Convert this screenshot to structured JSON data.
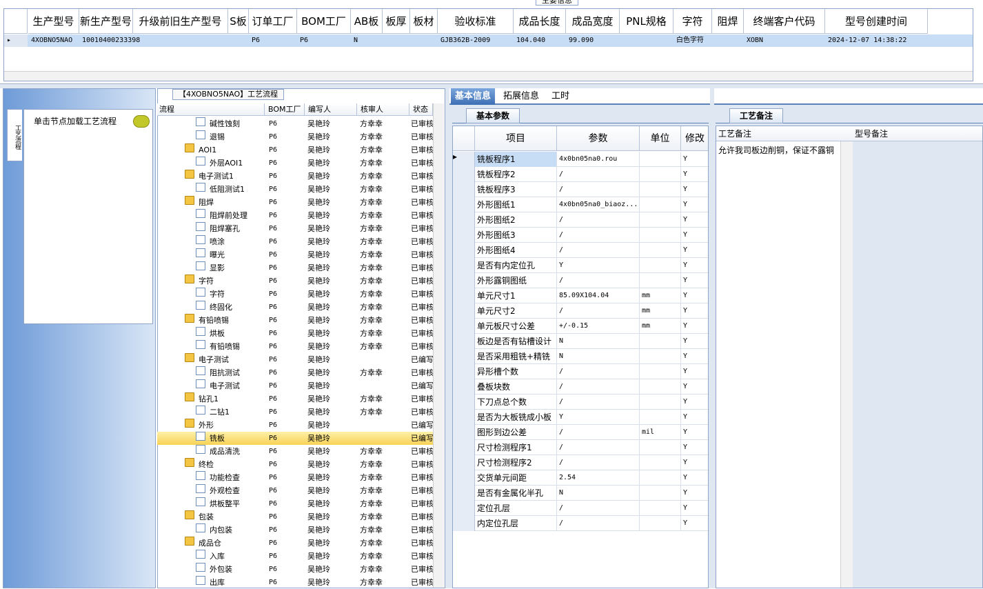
{
  "top": {
    "legend": "主要信息",
    "columns": [
      "生产型号",
      "新生产型号",
      "升级前旧生产型号",
      "S板",
      "订单工厂",
      "BOM工厂",
      "AB板",
      "板厚",
      "板材",
      "验收标准",
      "成品长度",
      "成品宽度",
      "PNL规格",
      "字符",
      "阻焊",
      "终端客户代码",
      "型号创建时间"
    ],
    "row": [
      "4XOBNO5NAO",
      "10010400233398",
      "",
      "",
      "P6",
      "P6",
      "N",
      "",
      "",
      "GJB362B-2009",
      "104.040",
      "99.090",
      "",
      "白色字符",
      "",
      "XOBN",
      "2024-12-07 14:38:22"
    ]
  },
  "left": {
    "vertical_tab": "工艺流程",
    "load_hint": "单击节点加载工艺流程"
  },
  "tree": {
    "legend": "【4XOBNO5NAO】工艺流程",
    "headers": [
      "流程",
      "BOM工厂",
      "编写人",
      "核审人",
      "状态"
    ],
    "nodes": [
      {
        "label": "碱性蚀刻",
        "level": 2,
        "folder": false,
        "bom": "P6",
        "writer": "吴艳玲",
        "checker": "方幸幸",
        "status": "已审核"
      },
      {
        "label": "退锡",
        "level": 2,
        "folder": false,
        "bom": "P6",
        "writer": "吴艳玲",
        "checker": "方幸幸",
        "status": "已审核"
      },
      {
        "label": "AOI1",
        "level": 1,
        "folder": true,
        "bom": "P6",
        "writer": "吴艳玲",
        "checker": "方幸幸",
        "status": "已审核"
      },
      {
        "label": "外层AOI1",
        "level": 2,
        "folder": false,
        "bom": "P6",
        "writer": "吴艳玲",
        "checker": "方幸幸",
        "status": "已审核"
      },
      {
        "label": "电子测试1",
        "level": 1,
        "folder": true,
        "bom": "P6",
        "writer": "吴艳玲",
        "checker": "方幸幸",
        "status": "已审核"
      },
      {
        "label": "低阻测试1",
        "level": 2,
        "folder": false,
        "bom": "P6",
        "writer": "吴艳玲",
        "checker": "方幸幸",
        "status": "已审核"
      },
      {
        "label": "阻焊",
        "level": 1,
        "folder": true,
        "bom": "P6",
        "writer": "吴艳玲",
        "checker": "方幸幸",
        "status": "已审核"
      },
      {
        "label": "阻焊前处理",
        "level": 2,
        "folder": false,
        "bom": "P6",
        "writer": "吴艳玲",
        "checker": "方幸幸",
        "status": "已审核"
      },
      {
        "label": "阻焊塞孔",
        "level": 2,
        "folder": false,
        "bom": "P6",
        "writer": "吴艳玲",
        "checker": "方幸幸",
        "status": "已审核"
      },
      {
        "label": "喷涂",
        "level": 2,
        "folder": false,
        "bom": "P6",
        "writer": "吴艳玲",
        "checker": "方幸幸",
        "status": "已审核"
      },
      {
        "label": "曝光",
        "level": 2,
        "folder": false,
        "bom": "P6",
        "writer": "吴艳玲",
        "checker": "方幸幸",
        "status": "已审核"
      },
      {
        "label": "显影",
        "level": 2,
        "folder": false,
        "bom": "P6",
        "writer": "吴艳玲",
        "checker": "方幸幸",
        "status": "已审核"
      },
      {
        "label": "字符",
        "level": 1,
        "folder": true,
        "bom": "P6",
        "writer": "吴艳玲",
        "checker": "方幸幸",
        "status": "已审核"
      },
      {
        "label": "字符",
        "level": 2,
        "folder": false,
        "bom": "P6",
        "writer": "吴艳玲",
        "checker": "方幸幸",
        "status": "已审核"
      },
      {
        "label": "终固化",
        "level": 2,
        "folder": false,
        "bom": "P6",
        "writer": "吴艳玲",
        "checker": "方幸幸",
        "status": "已审核"
      },
      {
        "label": "有铅喷锡",
        "level": 1,
        "folder": true,
        "bom": "P6",
        "writer": "吴艳玲",
        "checker": "方幸幸",
        "status": "已审核"
      },
      {
        "label": "烘板",
        "level": 2,
        "folder": false,
        "bom": "P6",
        "writer": "吴艳玲",
        "checker": "方幸幸",
        "status": "已审核"
      },
      {
        "label": "有铅喷锡",
        "level": 2,
        "folder": false,
        "bom": "P6",
        "writer": "吴艳玲",
        "checker": "方幸幸",
        "status": "已审核"
      },
      {
        "label": "电子测试",
        "level": 1,
        "folder": true,
        "bom": "P6",
        "writer": "吴艳玲",
        "checker": "",
        "status": "已编写"
      },
      {
        "label": "阻抗测试",
        "level": 2,
        "folder": false,
        "bom": "P6",
        "writer": "吴艳玲",
        "checker": "方幸幸",
        "status": "已审核"
      },
      {
        "label": "电子测试",
        "level": 2,
        "folder": false,
        "bom": "P6",
        "writer": "吴艳玲",
        "checker": "",
        "status": "已编写"
      },
      {
        "label": "钻孔1",
        "level": 1,
        "folder": true,
        "bom": "P6",
        "writer": "吴艳玲",
        "checker": "方幸幸",
        "status": "已审核"
      },
      {
        "label": "二钻1",
        "level": 2,
        "folder": false,
        "bom": "P6",
        "writer": "吴艳玲",
        "checker": "方幸幸",
        "status": "已审核"
      },
      {
        "label": "外形",
        "level": 1,
        "folder": true,
        "bom": "P6",
        "writer": "吴艳玲",
        "checker": "",
        "status": "已编写"
      },
      {
        "label": "铣板",
        "level": 2,
        "folder": false,
        "bom": "P6",
        "writer": "吴艳玲",
        "checker": "",
        "status": "已编写",
        "selected": true
      },
      {
        "label": "成品清洗",
        "level": 2,
        "folder": false,
        "bom": "P6",
        "writer": "吴艳玲",
        "checker": "方幸幸",
        "status": "已审核"
      },
      {
        "label": "终检",
        "level": 1,
        "folder": true,
        "bom": "P6",
        "writer": "吴艳玲",
        "checker": "方幸幸",
        "status": "已审核"
      },
      {
        "label": "功能检查",
        "level": 2,
        "folder": false,
        "bom": "P6",
        "writer": "吴艳玲",
        "checker": "方幸幸",
        "status": "已审核"
      },
      {
        "label": "外观检查",
        "level": 2,
        "folder": false,
        "bom": "P6",
        "writer": "吴艳玲",
        "checker": "方幸幸",
        "status": "已审核"
      },
      {
        "label": "烘板整平",
        "level": 2,
        "folder": false,
        "bom": "P6",
        "writer": "吴艳玲",
        "checker": "方幸幸",
        "status": "已审核"
      },
      {
        "label": "包装",
        "level": 1,
        "folder": true,
        "bom": "P6",
        "writer": "吴艳玲",
        "checker": "方幸幸",
        "status": "已审核"
      },
      {
        "label": "内包装",
        "level": 2,
        "folder": false,
        "bom": "P6",
        "writer": "吴艳玲",
        "checker": "方幸幸",
        "status": "已审核"
      },
      {
        "label": "成品仓",
        "level": 1,
        "folder": true,
        "bom": "P6",
        "writer": "吴艳玲",
        "checker": "方幸幸",
        "status": "已审核"
      },
      {
        "label": "入库",
        "level": 2,
        "folder": false,
        "bom": "P6",
        "writer": "吴艳玲",
        "checker": "方幸幸",
        "status": "已审核"
      },
      {
        "label": "外包装",
        "level": 2,
        "folder": false,
        "bom": "P6",
        "writer": "吴艳玲",
        "checker": "方幸幸",
        "status": "已审核"
      },
      {
        "label": "出库",
        "level": 2,
        "folder": false,
        "bom": "P6",
        "writer": "吴艳玲",
        "checker": "方幸幸",
        "status": "已审核"
      }
    ]
  },
  "right": {
    "tabs": [
      "基本信息",
      "拓展信息",
      "工时"
    ],
    "param_tab": "基本参数",
    "headers": [
      "项目",
      "参数",
      "单位",
      "修改"
    ],
    "rows": [
      {
        "item": "铣板程序1",
        "value": "4x0bn05na0.rou",
        "unit": "",
        "mod": "Y"
      },
      {
        "item": "铣板程序2",
        "value": "/",
        "unit": "",
        "mod": "Y"
      },
      {
        "item": "铣板程序3",
        "value": "/",
        "unit": "",
        "mod": "Y"
      },
      {
        "item": "外形图纸1",
        "value": "4x0bn05na0_biaoz...",
        "unit": "",
        "mod": "Y"
      },
      {
        "item": "外形图纸2",
        "value": "/",
        "unit": "",
        "mod": "Y"
      },
      {
        "item": "外形图纸3",
        "value": "/",
        "unit": "",
        "mod": "Y"
      },
      {
        "item": "外形图纸4",
        "value": "/",
        "unit": "",
        "mod": "Y"
      },
      {
        "item": "是否有内定位孔",
        "value": "Y",
        "unit": "",
        "mod": "Y"
      },
      {
        "item": "外形露铜图纸",
        "value": "/",
        "unit": "",
        "mod": "Y"
      },
      {
        "item": "单元尺寸1",
        "value": "85.09X104.04",
        "unit": "mm",
        "mod": "Y"
      },
      {
        "item": "单元尺寸2",
        "value": "/",
        "unit": "mm",
        "mod": "Y"
      },
      {
        "item": "单元板尺寸公差",
        "value": "+/-0.15",
        "unit": "mm",
        "mod": "Y"
      },
      {
        "item": "板边是否有钻槽设计",
        "value": "N",
        "unit": "",
        "mod": "Y"
      },
      {
        "item": "是否采用粗铣+精铣",
        "value": "N",
        "unit": "",
        "mod": "Y"
      },
      {
        "item": "异形槽个数",
        "value": "/",
        "unit": "",
        "mod": "Y"
      },
      {
        "item": "叠板块数",
        "value": "/",
        "unit": "",
        "mod": "Y"
      },
      {
        "item": "下刀点总个数",
        "value": "/",
        "unit": "",
        "mod": "Y"
      },
      {
        "item": "是否为大板铣成小板",
        "value": "Y",
        "unit": "",
        "mod": "Y"
      },
      {
        "item": "图形到边公差",
        "value": "/",
        "unit": "mil",
        "mod": "Y"
      },
      {
        "item": "尺寸检测程序1",
        "value": "/",
        "unit": "",
        "mod": "Y"
      },
      {
        "item": "尺寸检测程序2",
        "value": "/",
        "unit": "",
        "mod": "Y"
      },
      {
        "item": "交货单元间距",
        "value": "2.54",
        "unit": "",
        "mod": "Y"
      },
      {
        "item": "是否有金属化半孔",
        "value": "N",
        "unit": "",
        "mod": "Y"
      },
      {
        "item": "定位孔层",
        "value": "/",
        "unit": "",
        "mod": "Y"
      },
      {
        "item": "内定位孔层",
        "value": "/",
        "unit": "",
        "mod": "Y"
      }
    ],
    "note_tab": "工艺备注",
    "note_headers": [
      "工艺备注",
      "型号备注"
    ],
    "note_text": "允许我司板边削铜，保证不露铜"
  }
}
